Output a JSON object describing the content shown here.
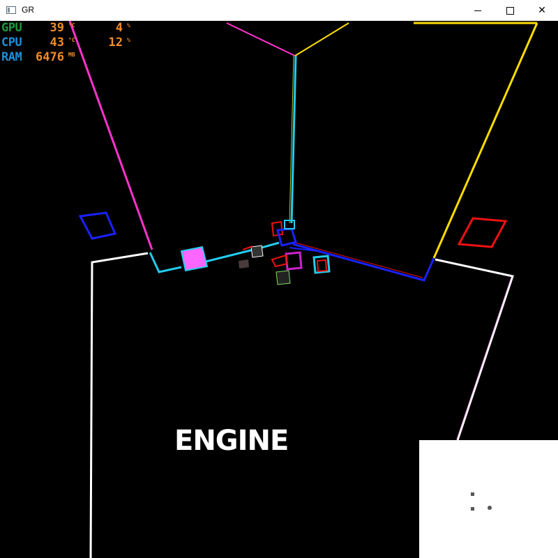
{
  "window": {
    "title": "GR",
    "controls": {
      "minimize": "minimize",
      "maximize": "maximize",
      "close": "✕"
    }
  },
  "hud": {
    "gpu": {
      "label": "GPU",
      "temp": "39",
      "temp_unit": "°C",
      "load": "4",
      "load_unit": "%",
      "label_color": "#1f9a3f"
    },
    "cpu": {
      "label": "CPU",
      "temp": "43",
      "temp_unit": "°C",
      "load": "12",
      "load_unit": "%",
      "label_color": "#1e8fd6"
    },
    "ram": {
      "label": "RAM",
      "value": "6476",
      "unit": "MB",
      "label_color": "#1e8fd6"
    },
    "value_color": "#f28c28"
  },
  "scene": {
    "overlay_text": "ENGINE",
    "colors": {
      "magenta": "#ff33cc",
      "yellow": "#ffdd00",
      "cyan": "#22ccee",
      "blue": "#1a22ff",
      "red": "#ee1111",
      "white": "#ffffff"
    }
  },
  "minimap": {
    "background": "#ffffff",
    "marker_color": "#555555"
  }
}
